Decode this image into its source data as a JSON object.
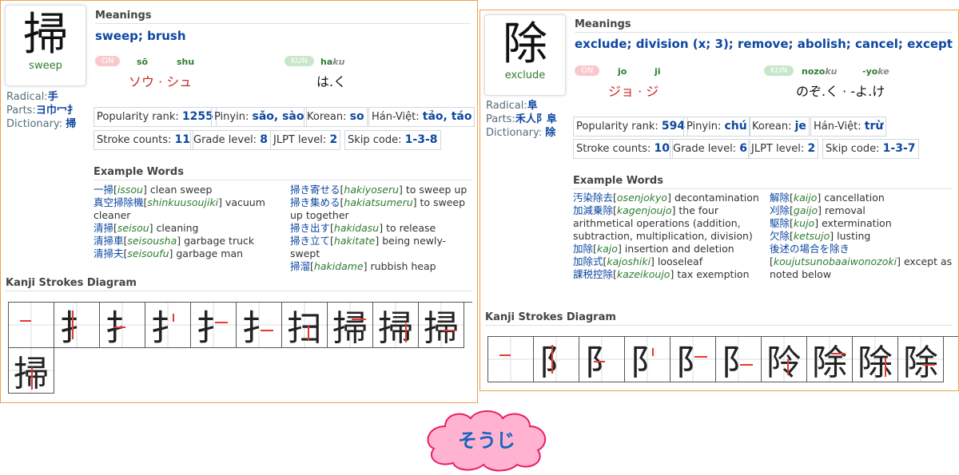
{
  "cards": [
    {
      "kanji": "掃",
      "meaning_short": "sweep",
      "radical_label": "Radical:",
      "radical": "手",
      "parts_label": "Parts:",
      "parts": "ヨ巾冖扌",
      "dictionary_label": "Dictionary:",
      "dictionary": "掃",
      "meanings_header": "Meanings",
      "meanings": "sweep; brush",
      "on_label": "ON",
      "kun_label": "KUN",
      "on_romaji_1": "sō",
      "on_romaji_2": "shu",
      "on_kana": "ソウ · シュ",
      "kun_romaji_main": "ha",
      "kun_romaji_ok": "ku",
      "kun_kana": "は.く",
      "stats": [
        {
          "label": "Popularity rank:",
          "value": "1255"
        },
        {
          "label": "Pinyin:",
          "value": "sǎo, sào"
        },
        {
          "label": "Korean:",
          "value": "so"
        },
        {
          "label": "Hán-Việt:",
          "value": "tảo, táo"
        },
        {
          "label": "Stroke counts:",
          "value": "11"
        },
        {
          "label": "Grade level:",
          "value": "8"
        },
        {
          "label": "JLPT level:",
          "value": "2"
        },
        {
          "label": "Skip code:",
          "value": "1-3-8"
        }
      ],
      "examples_header": "Example Words",
      "examples_left": [
        {
          "w": "一掃",
          "r": "issou",
          "m": "clean sweep"
        },
        {
          "w": "真空掃除機",
          "r": "shinkuusoujiki",
          "m": "vacuum cleaner"
        },
        {
          "w": "清掃",
          "r": "seisou",
          "m": "cleaning"
        },
        {
          "w": "清掃車",
          "r": "seisousha",
          "m": "garbage truck"
        },
        {
          "w": "清掃夫",
          "r": "seisoufu",
          "m": "garbage man"
        }
      ],
      "examples_right": [
        {
          "w": "掃き寄せる",
          "r": "hakiyoseru",
          "m": "to sweep up"
        },
        {
          "w": "掃き集める",
          "r": "hakiatsumeru",
          "m": "to sweep up together"
        },
        {
          "w": "掃き出す",
          "r": "hakidasu",
          "m": "to release"
        },
        {
          "w": "掃き立て",
          "r": "hakitate",
          "m": "being newly-swept"
        },
        {
          "w": "掃溜",
          "r": "hakidame",
          "m": "rubbish heap"
        }
      ],
      "strokes_header": "Kanji Strokes Diagram",
      "stroke_glyphs": [
        "",
        "扌",
        "扌",
        "扌",
        "扌",
        "扌",
        "扫",
        "掃",
        "掃",
        "掃",
        "掃"
      ]
    },
    {
      "kanji": "除",
      "meaning_short": "exclude",
      "radical_label": "Radical:",
      "radical": "阜",
      "parts_label": "Parts:",
      "parts": "禾人阝阜",
      "dictionary_label": "Dictionary:",
      "dictionary": "除",
      "meanings_header": "Meanings",
      "meanings": "exclude; division (x; 3); remove; abolish; cancel; except",
      "on_label": "ON",
      "kun_label": "KUN",
      "on_romaji_1": "jo",
      "on_romaji_2": "ji",
      "on_kana": "ジョ · ジ",
      "kun_romaji_main": "nozo",
      "kun_romaji_ok": "ku",
      "kun_romaji_main_2": "-yo",
      "kun_romaji_ok_2": "ke",
      "kun_kana": "のぞ.く · -よ.け",
      "stats": [
        {
          "label": "Popularity rank:",
          "value": "594"
        },
        {
          "label": "Pinyin:",
          "value": "chú"
        },
        {
          "label": "Korean:",
          "value": "je"
        },
        {
          "label": "Hán-Việt:",
          "value": "trừ"
        },
        {
          "label": "Stroke counts:",
          "value": "10"
        },
        {
          "label": "Grade level:",
          "value": "6"
        },
        {
          "label": "JLPT level:",
          "value": "2"
        },
        {
          "label": "Skip code:",
          "value": "1-3-7"
        }
      ],
      "examples_header": "Example Words",
      "examples_left": [
        {
          "w": "汚染除去",
          "r": "osenjokyo",
          "m": "decontamination"
        },
        {
          "w": "加減乗除",
          "r": "kagenjoujo",
          "m": "the four arithmetical operations (addition, subtraction, multiplication, division)"
        },
        {
          "w": "加除",
          "r": "kajo",
          "m": "insertion and deletion"
        },
        {
          "w": "加除式",
          "r": "kajoshiki",
          "m": "looseleaf"
        },
        {
          "w": "課税控除",
          "r": "kazeikoujo",
          "m": "tax exemption"
        }
      ],
      "examples_right": [
        {
          "w": "解除",
          "r": "kaijo",
          "m": "cancellation"
        },
        {
          "w": "刈除",
          "r": "gaijo",
          "m": "removal"
        },
        {
          "w": "駆除",
          "r": "kujo",
          "m": "extermination"
        },
        {
          "w": "欠除",
          "r": "ketsujo",
          "m": "lusting"
        },
        {
          "w": "後述の場合を除き",
          "r": "koujutsunobaaiwonozoki",
          "m": "except as noted below"
        }
      ],
      "strokes_header": "Kanji Strokes Diagram",
      "stroke_glyphs": [
        "",
        "阝",
        "阝",
        "阝",
        "阝",
        "阝",
        "阾",
        "除",
        "除",
        "除"
      ]
    }
  ],
  "reading_bubble": {
    "text": "そうじ",
    "fill": "#ffb3d1",
    "text_color": "#1565c0"
  }
}
